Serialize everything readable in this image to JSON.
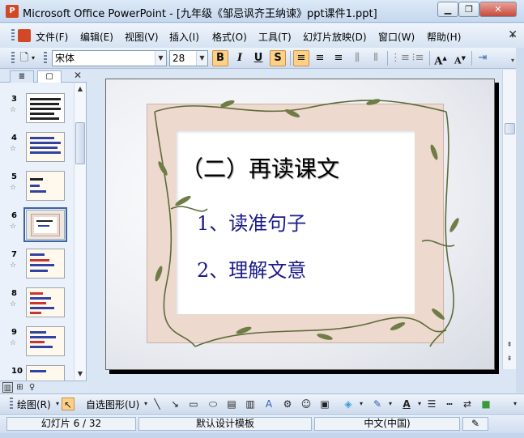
{
  "window": {
    "title": "Microsoft Office PowerPoint - [九年级《邹忌讽齐王纳谏》ppt课件1.ppt]",
    "app_icon": "powerpoint-icon",
    "controls": [
      "minimize",
      "restore",
      "close"
    ]
  },
  "menubar": {
    "items": [
      "文件(F)",
      "编辑(E)",
      "视图(V)",
      "插入(I)",
      "格式(O)",
      "工具(T)",
      "幻灯片放映(D)",
      "窗口(W)",
      "帮助(H)"
    ],
    "close_glyph": "✕"
  },
  "toolbar": {
    "font_name": "宋体",
    "font_size": "28",
    "bold": "B",
    "italic": "I",
    "underline": "U",
    "shadow": "S",
    "grow_font": "A",
    "shrink_font": "A"
  },
  "left_pane": {
    "tab_outline_glyph": "≣",
    "tab_slides_glyph": "▢",
    "close_glyph": "✕",
    "thumbnails": [
      {
        "num": "3",
        "star": "☆"
      },
      {
        "num": "4",
        "star": "☆"
      },
      {
        "num": "5",
        "star": "☆"
      },
      {
        "num": "6",
        "star": "☆"
      },
      {
        "num": "7",
        "star": "☆"
      },
      {
        "num": "8",
        "star": "☆"
      },
      {
        "num": "9",
        "star": "☆"
      },
      {
        "num": "10",
        "star": ""
      }
    ],
    "selected": "6"
  },
  "slide": {
    "title": "（二）再读课文",
    "bullets": [
      "1、读准句子",
      "2、理解文意"
    ],
    "title_color": "#000000",
    "bullet_color": "#1a1a8c"
  },
  "drawbar": {
    "draw_label": "绘图(R)",
    "autoshapes_label": "自选图形(U)"
  },
  "statusbar": {
    "slide_pos": "幻灯片 6 / 32",
    "design": "默认设计模板",
    "language": "中文(中国)"
  },
  "colors": {
    "accent": "#d24726",
    "selection": "#fcd186",
    "chrome": "#dbe6f4"
  }
}
